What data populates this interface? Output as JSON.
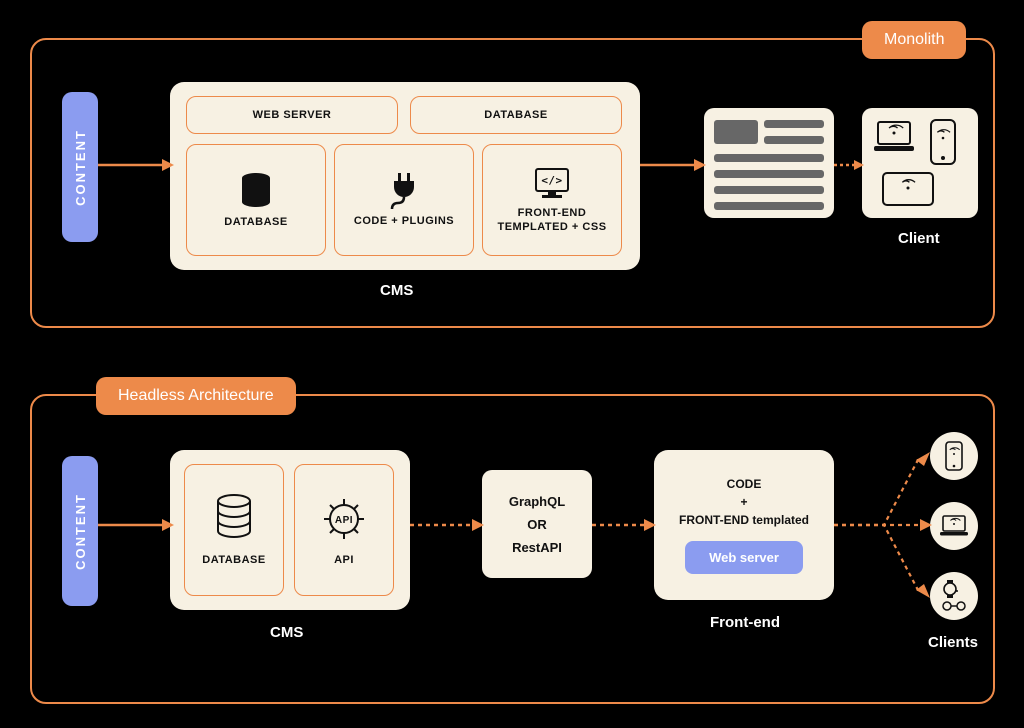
{
  "monolith": {
    "badge": "Monolith",
    "content": "CONTENT",
    "cms_label": "CMS",
    "web_server": "WEB SERVER",
    "database_top": "DATABASE",
    "database": "DATABASE",
    "code_plugins": "CODE + PLUGINS",
    "frontend_line1": "FRONT-END",
    "frontend_line2": "TEMPLATED + CSS",
    "client": "Client"
  },
  "headless": {
    "badge": "Headless Architecture",
    "content": "CONTENT",
    "cms_label": "CMS",
    "database": "DATABASE",
    "api": "API",
    "graphql": "GraphQL",
    "or": "OR",
    "restapi": "RestAPI",
    "fe_code": "CODE",
    "fe_plus": "+",
    "fe_tmpl": "FRONT-END templated",
    "web_server": "Web server",
    "frontend_label": "Front-end",
    "clients": "Clients"
  }
}
